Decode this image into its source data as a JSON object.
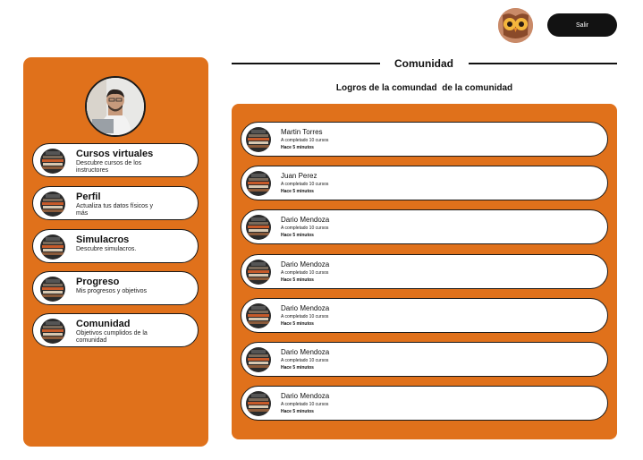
{
  "header": {
    "logo_icon": "owl-logo-icon",
    "logout_label": "Salir"
  },
  "sidebar": {
    "items": [
      {
        "title": "Cursos virtuales",
        "description": "Descubre cursos de los instructores"
      },
      {
        "title": "Perfil",
        "description": "Actualiza tus datos físicos y más"
      },
      {
        "title": "Simulacros",
        "description": "Descubre simulacros."
      },
      {
        "title": "Progreso",
        "description": "Mis progresos y objetivos"
      },
      {
        "title": "Comunidad",
        "description": "Objetivos cumplidos de la comunidad"
      }
    ]
  },
  "main": {
    "title": "Comunidad",
    "subtitle": "Logros de la comundad  de la comunidad",
    "feed": [
      {
        "name": "Martin Torres",
        "achievement": "A completado 10 cursos",
        "time": "Hace 5 minutos"
      },
      {
        "name": "Juan Perez",
        "achievement": "A completado 10 cursos",
        "time": "Hace 5 minutos"
      },
      {
        "name": "Dario Mendoza",
        "achievement": "A completado 10 cursos",
        "time": "Hace 5 minutos"
      },
      {
        "name": "Dario Mendoza",
        "achievement": "A completado 10 cursos",
        "time": "Hace 5 minutos"
      },
      {
        "name": "Dario Mendoza",
        "achievement": "A completado 10 cursos",
        "time": "Hace 5 minutos"
      },
      {
        "name": "Dario Mendoza",
        "achievement": "A completado 10 cursos",
        "time": "Hace 5 minutos"
      },
      {
        "name": "Dario Mendoza",
        "achievement": "A completado 10 cursos",
        "time": "Hace 5 minutos"
      }
    ]
  },
  "colors": {
    "accent": "#e0711b",
    "dark": "#121212"
  }
}
